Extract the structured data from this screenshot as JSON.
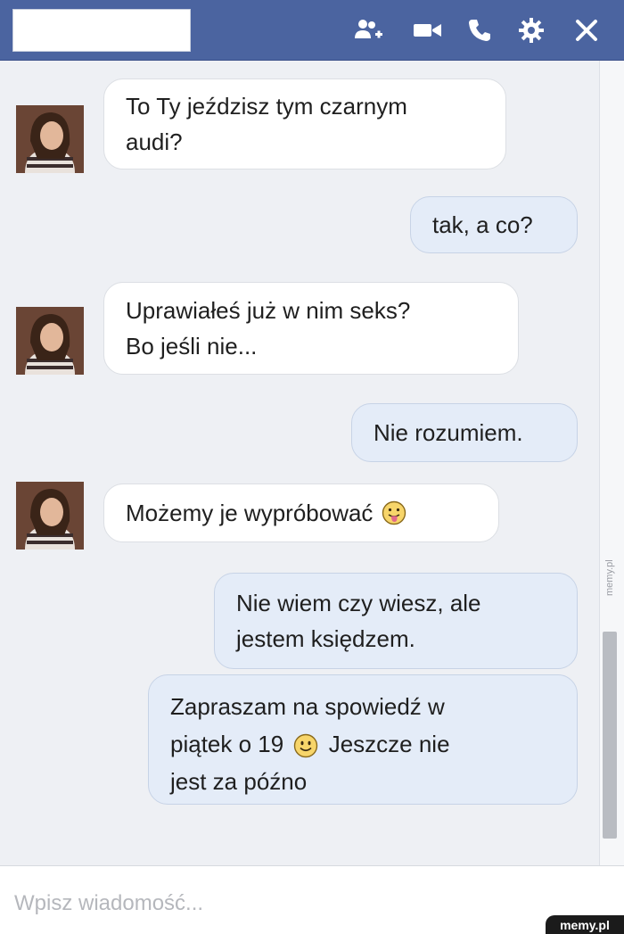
{
  "header": {
    "contact_name": "",
    "icons": [
      "add-friend-icon",
      "video-call-icon",
      "phone-icon",
      "gear-icon",
      "close-icon"
    ]
  },
  "messages": [
    {
      "sender": "them",
      "text": "To Ty jeździsz tym czarnym\naudi?"
    },
    {
      "sender": "me",
      "text": "tak, a co?"
    },
    {
      "sender": "them",
      "text": "Uprawiałeś już w nim seks?\nBo jeśli nie..."
    },
    {
      "sender": "me",
      "text": "Nie rozumiem."
    },
    {
      "sender": "them",
      "text": "Możemy je wypróbować",
      "emoji": "tongue-out-emoji"
    },
    {
      "sender": "me",
      "text": "Nie wiem czy wiesz, ale\njestem księdzem."
    },
    {
      "sender": "me",
      "text_before": "Zapraszam na spowiedź w\npiątek o 19",
      "emoji": "smile-emoji",
      "text_after": "Jeszcze nie\njest za późno"
    }
  ],
  "composer": {
    "placeholder": "Wpisz wiadomość..."
  },
  "watermark": {
    "side": "memy.pl",
    "corner": "memy.pl"
  },
  "colors": {
    "header": "#4b64a0",
    "background": "#eef0f4",
    "bubble_in": "#ffffff",
    "bubble_out": "#e4ecf8"
  }
}
